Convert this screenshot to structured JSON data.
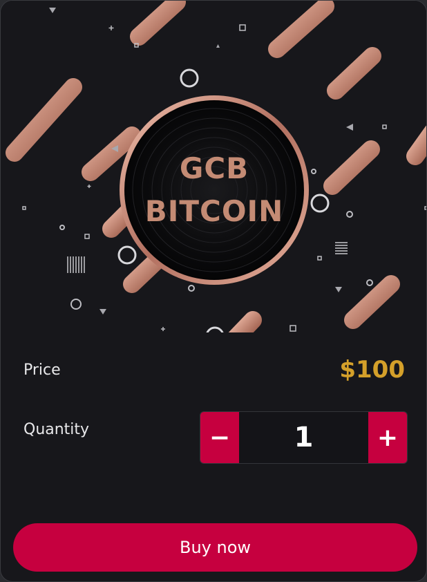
{
  "hero": {
    "coin_line1": "GCB",
    "coin_line2": "BITCOIN",
    "icon": "coin-icon",
    "colors": {
      "background": "#17171b",
      "copper": "#c48b74",
      "accent": "#c6003f"
    }
  },
  "price": {
    "label": "Price",
    "value": "$100",
    "value_color": "#d4a02a"
  },
  "quantity": {
    "label": "Quantity",
    "value": "1",
    "decrement_label": "−",
    "increment_label": "+"
  },
  "buy": {
    "label": "Buy now"
  }
}
